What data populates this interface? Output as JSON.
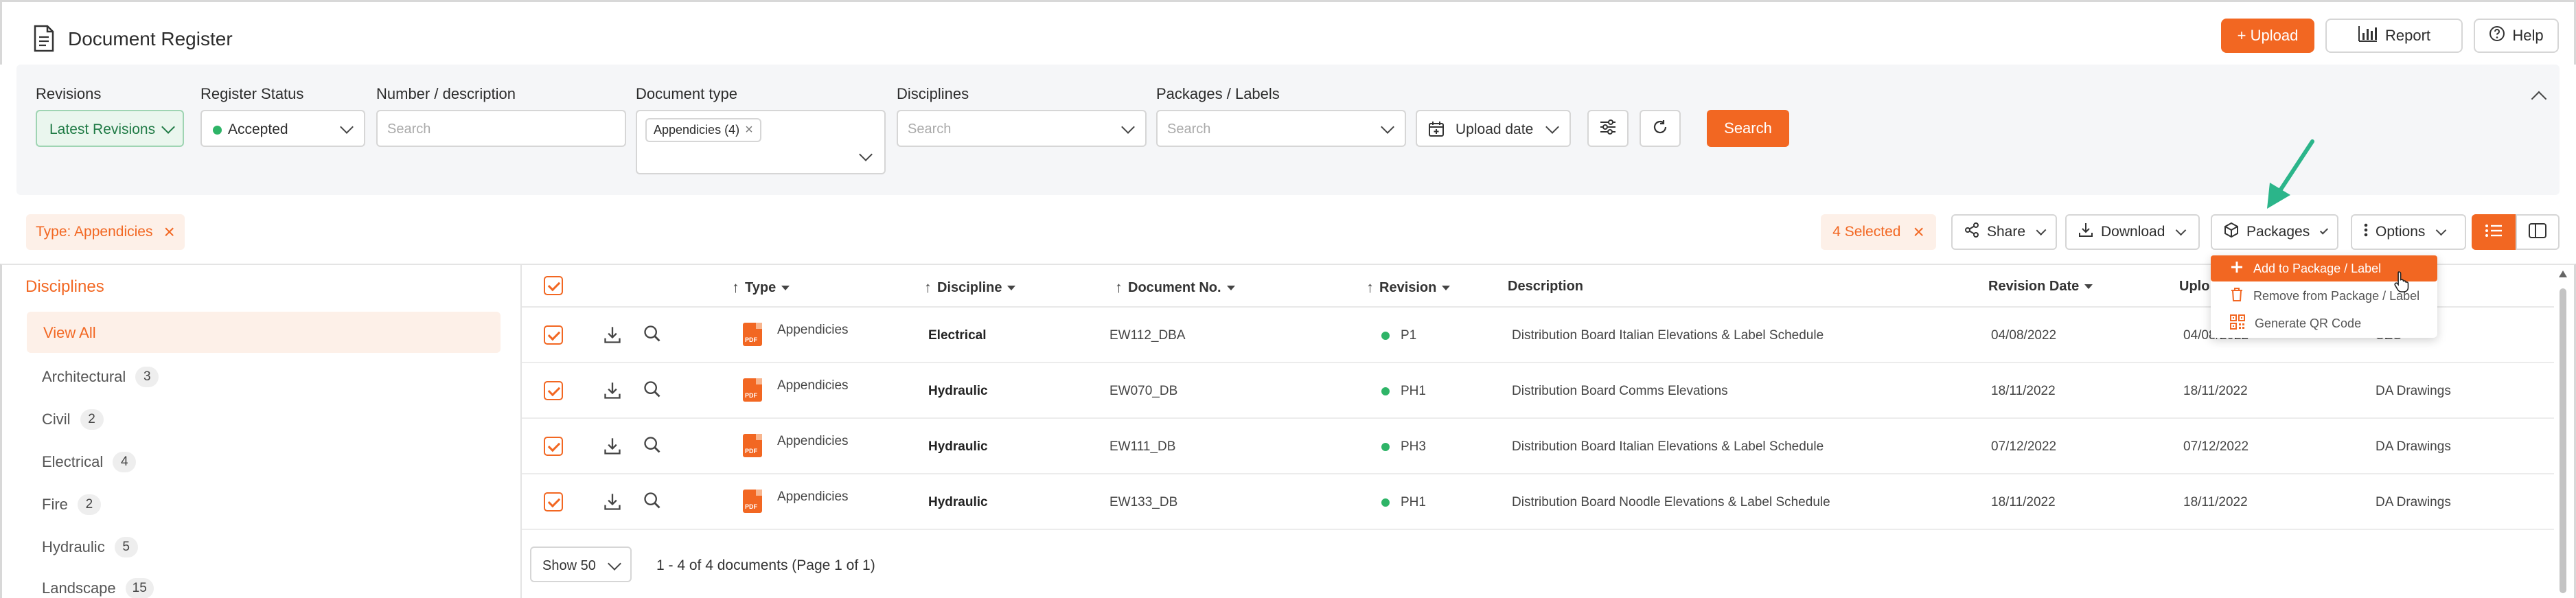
{
  "header": {
    "title": "Document Register",
    "upload_label": "+ Upload",
    "report_label": "Report",
    "help_label": "Help"
  },
  "filters": {
    "revisions": {
      "label": "Revisions",
      "value": "Latest Revisions"
    },
    "register_status": {
      "label": "Register Status",
      "value": "Accepted"
    },
    "number_description": {
      "label": "Number / description",
      "placeholder": "Search"
    },
    "document_type": {
      "label": "Document type",
      "tag": "Appendicies (4)"
    },
    "disciplines": {
      "label": "Disciplines",
      "placeholder": "Search"
    },
    "packages_labels": {
      "label": "Packages / Labels",
      "placeholder": "Search"
    },
    "upload_date_label": "Upload date",
    "search_button": "Search"
  },
  "toolbar": {
    "type_chip": "Type: Appendicies",
    "selected_chip": "4 Selected",
    "share_label": "Share",
    "download_label": "Download",
    "packages_label": "Packages",
    "options_label": "Options"
  },
  "packages_menu": {
    "items": [
      "Add to Package / Label",
      "Remove from Package / Label",
      "Generate QR Code"
    ]
  },
  "sidebar": {
    "title": "Disciplines",
    "view_all": "View All",
    "items": [
      {
        "label": "Architectural",
        "count": "3"
      },
      {
        "label": "Civil",
        "count": "2"
      },
      {
        "label": "Electrical",
        "count": "4"
      },
      {
        "label": "Fire",
        "count": "2"
      },
      {
        "label": "Hydraulic",
        "count": "5"
      },
      {
        "label": "Landscape",
        "count": "15"
      }
    ]
  },
  "table": {
    "columns": {
      "type": "Type",
      "discipline": "Discipline",
      "document_no": "Document No.",
      "revision": "Revision",
      "description": "Description",
      "revision_date": "Revision Date",
      "upload_date": "Uplo"
    },
    "rows": [
      {
        "type": "Appendicies",
        "discipline": "Electrical",
        "doc_no": "EW112_DBA",
        "revision": "P1",
        "description": "Distribution Board Italian Elevations & Label Schedule",
        "revision_date": "04/08/2022",
        "upload_date": "04/08/2022",
        "extra": "SES"
      },
      {
        "type": "Appendicies",
        "discipline": "Hydraulic",
        "doc_no": "EW070_DB",
        "revision": "PH1",
        "description": "Distribution Board Comms Elevations",
        "revision_date": "18/11/2022",
        "upload_date": "18/11/2022",
        "extra": "DA Drawings"
      },
      {
        "type": "Appendicies",
        "discipline": "Hydraulic",
        "doc_no": "EW111_DB",
        "revision": "PH3",
        "description": "Distribution Board Italian Elevations & Label Schedule",
        "revision_date": "07/12/2022",
        "upload_date": "07/12/2022",
        "extra": "DA Drawings"
      },
      {
        "type": "Appendicies",
        "discipline": "Hydraulic",
        "doc_no": "EW133_DB",
        "revision": "PH1",
        "description": "Distribution Board Noodle Elevations & Label Schedule",
        "revision_date": "18/11/2022",
        "upload_date": "18/11/2022",
        "extra": "DA Drawings"
      }
    ]
  },
  "footer": {
    "show_label": "Show 50",
    "pager_text": "1 - 4 of 4 documents (Page 1 of 1)"
  },
  "colors": {
    "accent": "#f26722",
    "accent_light": "#fdf0e8",
    "status_green": "#2eb467"
  }
}
